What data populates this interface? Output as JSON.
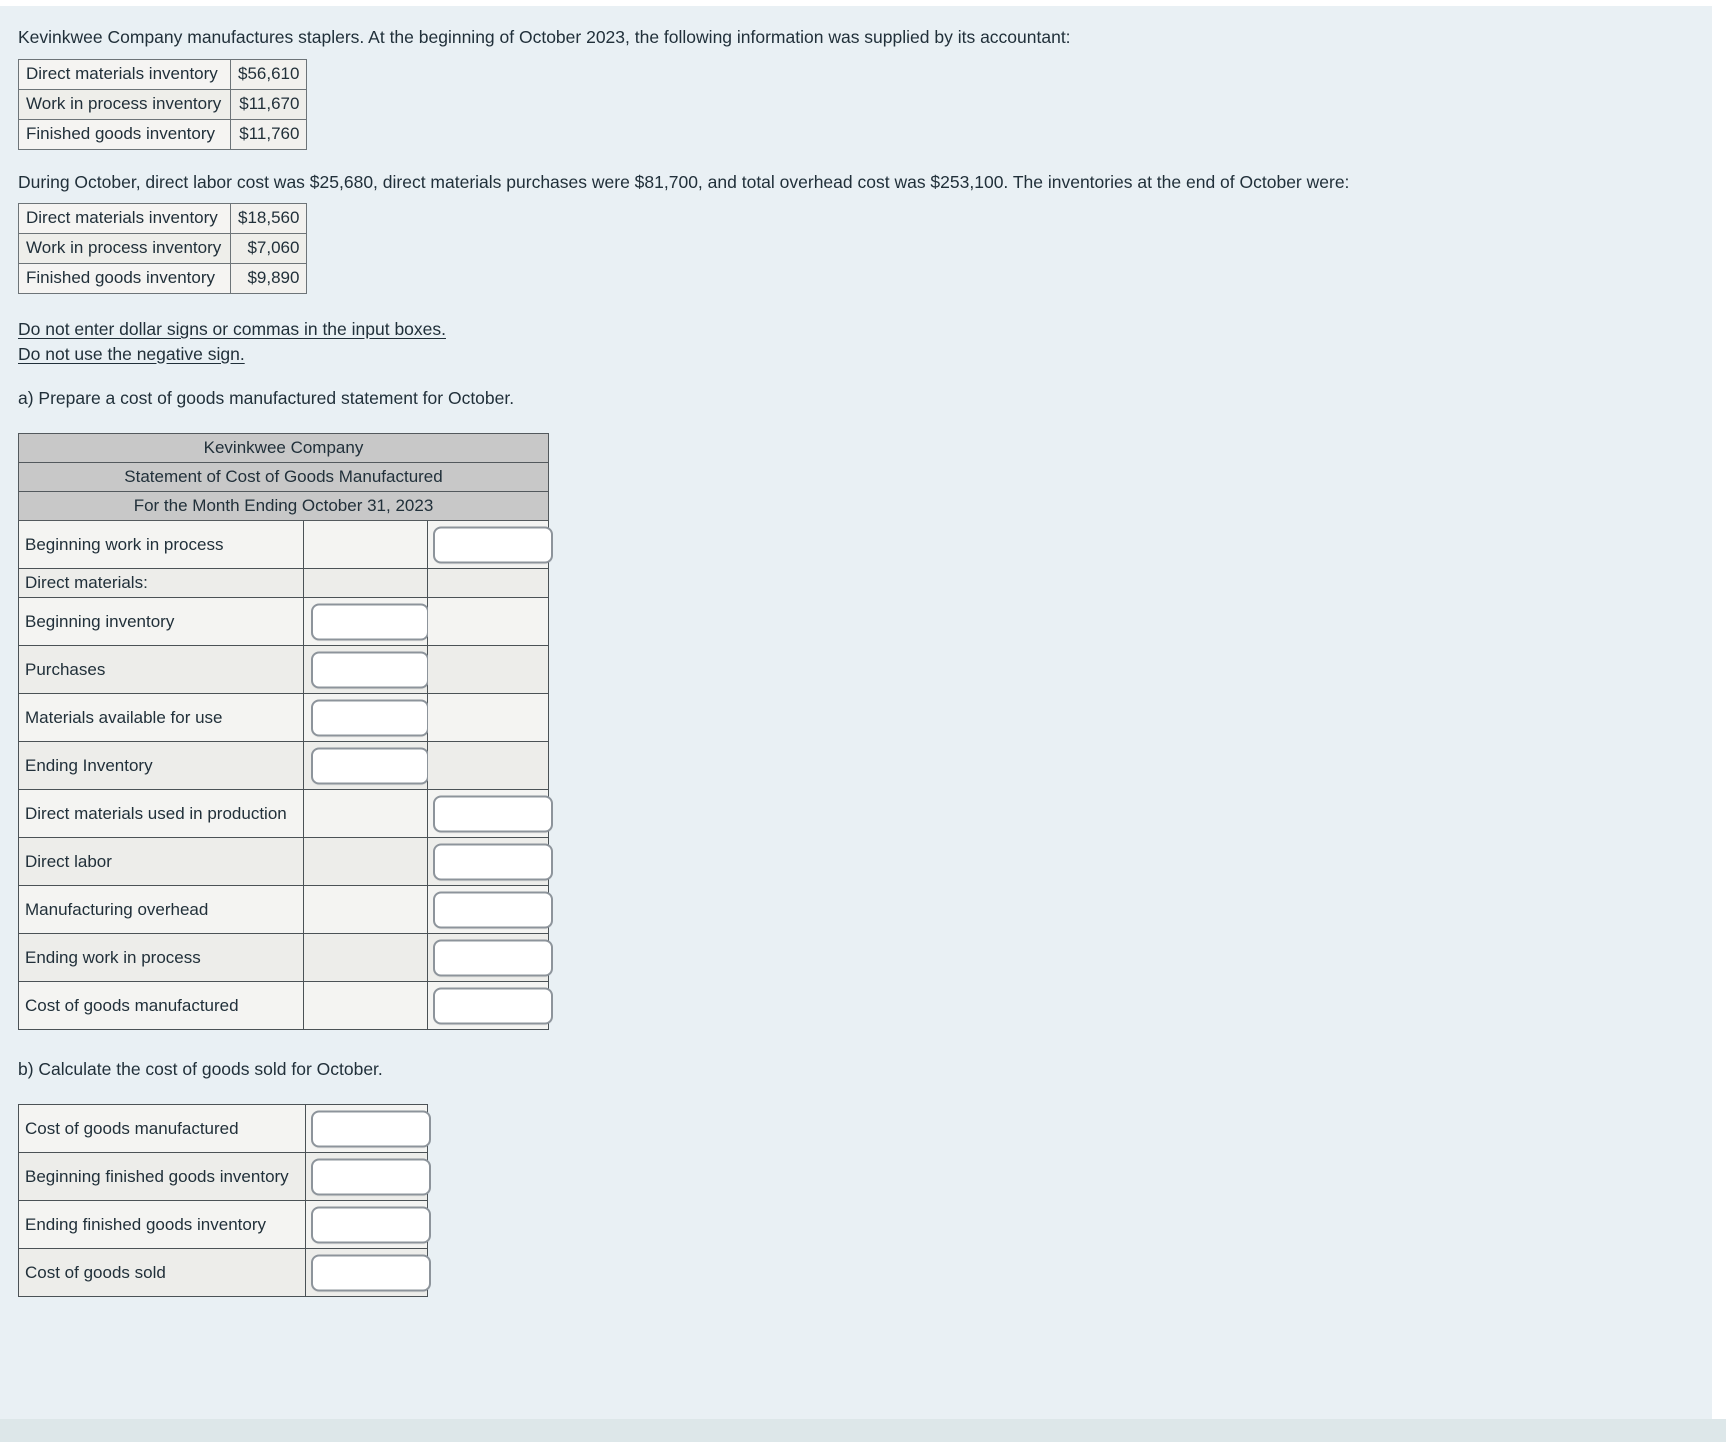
{
  "intro": {
    "paragraph": "Kevinkwee Company manufactures staplers. At the beginning of October 2023, the following information was supplied by its accountant:",
    "during_paragraph": "During October, direct labor cost was $25,680, direct materials purchases were $81,700, and total overhead cost was $253,100. The inventories at the end of October were:"
  },
  "given_beginning": {
    "rows": [
      {
        "label": "Direct materials inventory",
        "value": "$56,610"
      },
      {
        "label": "Work in process inventory",
        "value": "$11,670"
      },
      {
        "label": "Finished goods inventory",
        "value": "$11,760"
      }
    ]
  },
  "given_ending": {
    "rows": [
      {
        "label": "Direct materials inventory",
        "value": "$18,560"
      },
      {
        "label": "Work in process inventory",
        "value": "$7,060"
      },
      {
        "label": "Finished goods inventory",
        "value": "$9,890"
      }
    ]
  },
  "instructions": {
    "line1": "Do not enter dollar signs or commas in the input boxes.",
    "line2": "Do not use the negative sign."
  },
  "part_a": {
    "prompt": "a) Prepare a cost of goods manufactured statement for October.",
    "title_lines": [
      "Kevinkwee Company",
      "Statement of Cost of Goods Manufactured",
      "For the Month Ending October 31, 2023"
    ],
    "rows": [
      {
        "label": "Beginning work in process",
        "input_column": "right",
        "value": ""
      },
      {
        "label": "Direct materials:",
        "input_column": "none",
        "value": ""
      },
      {
        "label": "Beginning inventory",
        "input_column": "middle",
        "value": ""
      },
      {
        "label": "Purchases",
        "input_column": "middle",
        "value": ""
      },
      {
        "label": "Materials available for use",
        "input_column": "middle",
        "value": ""
      },
      {
        "label": "Ending Inventory",
        "input_column": "middle",
        "value": ""
      },
      {
        "label": "Direct materials used in production",
        "input_column": "right",
        "value": ""
      },
      {
        "label": "Direct labor",
        "input_column": "right",
        "value": ""
      },
      {
        "label": "Manufacturing overhead",
        "input_column": "right",
        "value": ""
      },
      {
        "label": "Ending work in process",
        "input_column": "right",
        "value": ""
      },
      {
        "label": "Cost of goods manufactured",
        "input_column": "right",
        "value": ""
      }
    ]
  },
  "part_b": {
    "prompt": "b) Calculate the cost of goods sold for October.",
    "rows": [
      {
        "label": "Cost of goods manufactured",
        "value": ""
      },
      {
        "label": "Beginning finished goods inventory",
        "value": ""
      },
      {
        "label": "Ending finished goods inventory",
        "value": ""
      },
      {
        "label": "Cost of goods sold",
        "value": ""
      }
    ]
  },
  "theme": {
    "page_background": "#e9f0f4",
    "header_background": "#c8c8c8",
    "row_light": "#f4f4f2",
    "row_dark": "#ededea",
    "text_color": "#21303a",
    "input_border": "#8d949b"
  }
}
